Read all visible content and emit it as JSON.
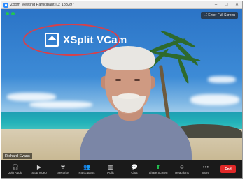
{
  "window": {
    "title": "Zoom Meeting Participant ID: 183397"
  },
  "video": {
    "brand_text": "XSplit VCam",
    "fullscreen_label": "Enter Full Screen",
    "participant_name": "Richard Evans"
  },
  "toolbar": {
    "items": [
      {
        "label": "Join Audio",
        "icon": "headphones-icon"
      },
      {
        "label": "Stop Video",
        "icon": "video-camera-icon"
      },
      {
        "label": "Security",
        "icon": "shield-icon"
      },
      {
        "label": "Participants",
        "icon": "participants-icon"
      },
      {
        "label": "Polls",
        "icon": "polls-icon"
      },
      {
        "label": "Chat",
        "icon": "chat-icon"
      },
      {
        "label": "Share Screen",
        "icon": "share-screen-icon"
      },
      {
        "label": "Reactions",
        "icon": "reactions-icon"
      },
      {
        "label": "More",
        "icon": "more-icon"
      }
    ],
    "end_label": "End"
  },
  "colors": {
    "share_green": "#23c552",
    "end_red": "#e02828",
    "highlight_red": "#d8404a"
  }
}
